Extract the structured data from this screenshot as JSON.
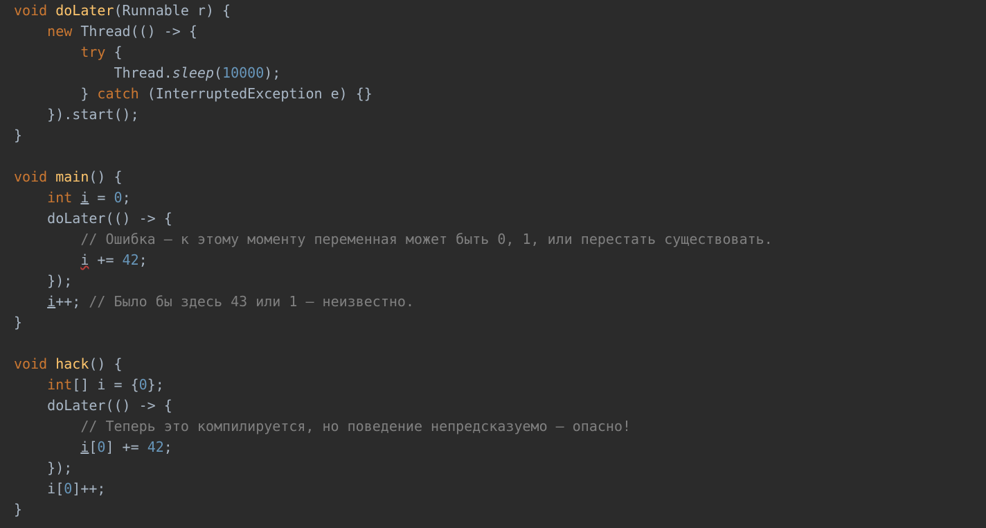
{
  "code": {
    "tokens": [
      [
        {
          "t": "void ",
          "c": "kw"
        },
        {
          "t": "doLater",
          "c": "fn"
        },
        {
          "t": "(Runnable r) {",
          "c": ""
        }
      ],
      [
        {
          "t": "    ",
          "c": ""
        },
        {
          "t": "new ",
          "c": "kw"
        },
        {
          "t": "Thread(() -> {",
          "c": ""
        }
      ],
      [
        {
          "t": "        ",
          "c": ""
        },
        {
          "t": "try ",
          "c": "kw"
        },
        {
          "t": "{",
          "c": ""
        }
      ],
      [
        {
          "t": "            Thread.",
          "c": ""
        },
        {
          "t": "sleep",
          "c": "st"
        },
        {
          "t": "(",
          "c": ""
        },
        {
          "t": "10000",
          "c": "num"
        },
        {
          "t": ");",
          "c": ""
        }
      ],
      [
        {
          "t": "        } ",
          "c": ""
        },
        {
          "t": "catch ",
          "c": "kw"
        },
        {
          "t": "(InterruptedException e) {}",
          "c": ""
        }
      ],
      [
        {
          "t": "    }).start();",
          "c": ""
        }
      ],
      [
        {
          "t": "}",
          "c": ""
        }
      ],
      [
        {
          "t": "",
          "c": ""
        }
      ],
      [
        {
          "t": "void ",
          "c": "kw"
        },
        {
          "t": "main",
          "c": "fn"
        },
        {
          "t": "() {",
          "c": ""
        }
      ],
      [
        {
          "t": "    ",
          "c": ""
        },
        {
          "t": "int ",
          "c": "kw"
        },
        {
          "t": "i",
          "c": "under"
        },
        {
          "t": " = ",
          "c": ""
        },
        {
          "t": "0",
          "c": "num"
        },
        {
          "t": ";",
          "c": ""
        }
      ],
      [
        {
          "t": "    doLater(() -> {",
          "c": ""
        }
      ],
      [
        {
          "t": "        ",
          "c": ""
        },
        {
          "t": "// Ошибка — к этому моменту переменная может быть 0, 1, или перестать существовать.",
          "c": "cm"
        }
      ],
      [
        {
          "t": "        ",
          "c": ""
        },
        {
          "t": "i",
          "c": "warn"
        },
        {
          "t": " += ",
          "c": ""
        },
        {
          "t": "42",
          "c": "num"
        },
        {
          "t": ";",
          "c": ""
        }
      ],
      [
        {
          "t": "    });",
          "c": ""
        }
      ],
      [
        {
          "t": "    ",
          "c": ""
        },
        {
          "t": "i",
          "c": "under"
        },
        {
          "t": "++; ",
          "c": ""
        },
        {
          "t": "// Было бы здесь 43 или 1 — неизвестно.",
          "c": "cm"
        }
      ],
      [
        {
          "t": "}",
          "c": ""
        }
      ],
      [
        {
          "t": "",
          "c": ""
        }
      ],
      [
        {
          "t": "void ",
          "c": "kw"
        },
        {
          "t": "hack",
          "c": "fn"
        },
        {
          "t": "() {",
          "c": ""
        }
      ],
      [
        {
          "t": "    ",
          "c": ""
        },
        {
          "t": "int",
          "c": "kw"
        },
        {
          "t": "[] i = {",
          "c": ""
        },
        {
          "t": "0",
          "c": "num"
        },
        {
          "t": "};",
          "c": ""
        }
      ],
      [
        {
          "t": "    doLater(() -> {",
          "c": ""
        }
      ],
      [
        {
          "t": "        ",
          "c": ""
        },
        {
          "t": "// Теперь это компилируется, но поведение непредсказуемо — опасно!",
          "c": "cm"
        }
      ],
      [
        {
          "t": "        ",
          "c": ""
        },
        {
          "t": "i",
          "c": "under"
        },
        {
          "t": "[",
          "c": ""
        },
        {
          "t": "0",
          "c": "num"
        },
        {
          "t": "] += ",
          "c": ""
        },
        {
          "t": "42",
          "c": "num"
        },
        {
          "t": ";",
          "c": ""
        }
      ],
      [
        {
          "t": "    });",
          "c": ""
        }
      ],
      [
        {
          "t": "    i[",
          "c": ""
        },
        {
          "t": "0",
          "c": "num"
        },
        {
          "t": "]++;",
          "c": ""
        }
      ],
      [
        {
          "t": "}",
          "c": ""
        }
      ]
    ]
  }
}
